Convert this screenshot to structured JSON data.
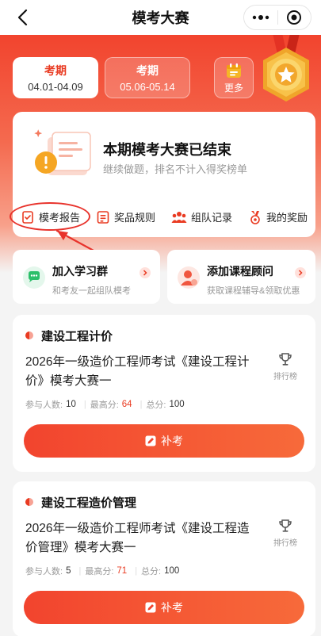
{
  "nav": {
    "title": "模考大赛"
  },
  "periods": [
    {
      "label": "考期",
      "date": "04.01-04.09",
      "active": true
    },
    {
      "label": "考期",
      "date": "05.06-05.14",
      "active": false
    }
  ],
  "more": {
    "label": "更多"
  },
  "status": {
    "title": "本期模考大赛已结束",
    "subtitle": "继续做题，排名不计入得奖榜单"
  },
  "quick_links": [
    {
      "label": "模考报告",
      "icon": "report-icon"
    },
    {
      "label": "奖品规则",
      "icon": "list-icon"
    },
    {
      "label": "组队记录",
      "icon": "team-icon"
    },
    {
      "label": "我的奖励",
      "icon": "award-icon"
    }
  ],
  "promos": [
    {
      "title": "加入学习群",
      "subtitle": "和考友一起组队模考",
      "icon": "chat-group-icon"
    },
    {
      "title": "添加课程顾问",
      "subtitle": "获取课程辅导&领取优惠",
      "icon": "advisor-icon"
    }
  ],
  "exams": [
    {
      "subject": "建设工程计价",
      "name": "2026年一级造价工程师考试《建设工程计价》模考大赛一",
      "rank_label": "排行榜",
      "participants_label": "参与人数:",
      "participants": "10",
      "highest_label": "最高分:",
      "highest": "64",
      "total_label": "总分:",
      "total": "100",
      "button": "补考"
    },
    {
      "subject": "建设工程造价管理",
      "name": "2026年一级造价工程师考试《建设工程造价管理》模考大赛一",
      "rank_label": "排行榜",
      "participants_label": "参与人数:",
      "participants": "5",
      "highest_label": "最高分:",
      "highest": "71",
      "total_label": "总分:",
      "total": "100",
      "button": "补考"
    }
  ],
  "colors": {
    "accent": "#e93b22",
    "gold": "#f5b626"
  }
}
